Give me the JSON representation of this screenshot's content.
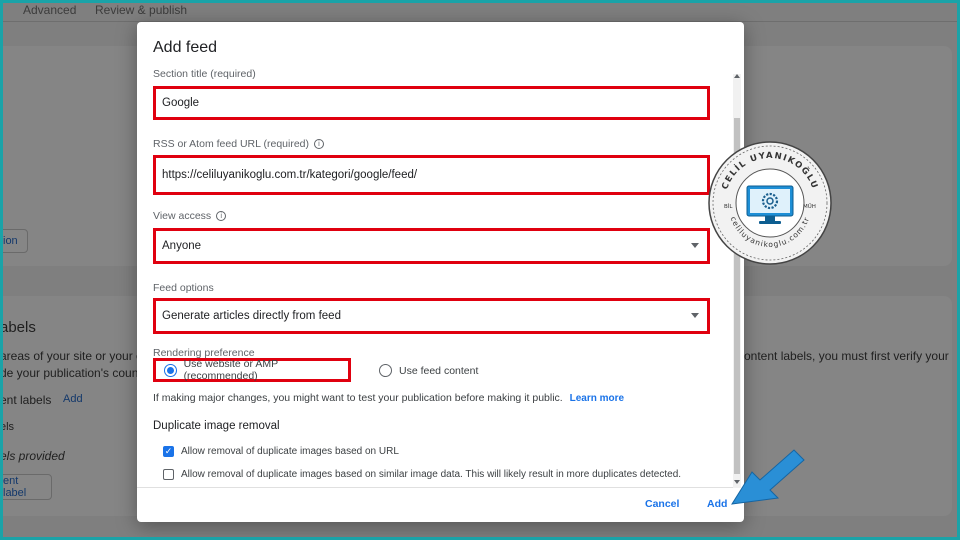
{
  "background": {
    "tabs": [
      "Advanced",
      "Review & publish"
    ],
    "partial_button_1": "ion",
    "labels_heading": "abels",
    "desc_line_1": "areas of your site or your ent",
    "desc_line_2": "de your publication's country",
    "right_text_1": "content labels, you must first verify your",
    "right_text_2": "r",
    "content_labels": "ent labels",
    "add_link": "Add",
    "labels_item": "els",
    "labels_provided": "els provided",
    "content_label_button": "ent label"
  },
  "dialog": {
    "title": "Add feed",
    "section_title": {
      "label": "Section title (required)",
      "value": "Google"
    },
    "feed_url": {
      "label": "RSS or Atom feed URL (required)",
      "value": "https://celiluyanikoglu.com.tr/kategori/google/feed/",
      "info_icon": "info-icon"
    },
    "view_access": {
      "label": "View access",
      "value": "Anyone",
      "info_icon": "info-icon"
    },
    "feed_options": {
      "label": "Feed options",
      "value": "Generate articles directly from feed"
    },
    "rendering": {
      "label": "Rendering preference",
      "option_amp": "Use website or AMP (recommended)",
      "option_feed": "Use feed content",
      "selected": "option_amp"
    },
    "hint": "If making major changes, you might want to test your publication before making it public.",
    "learn_more": "Learn more",
    "duplicate": {
      "heading": "Duplicate image removal",
      "url_option": "Allow removal of duplicate images based on URL",
      "url_checked": true,
      "similar_option": "Allow removal of duplicate images based on similar image data. This will likely result in more duplicates detected.",
      "similar_checked": false
    },
    "cancel": "Cancel",
    "add": "Add"
  },
  "stamp": {
    "name": "CELİL UYANIKOĞLU",
    "left": "BİL",
    "right": "MÜH",
    "site": "celiluyanikoglu.com.tr"
  },
  "colors": {
    "accent": "#1a73e8",
    "highlight": "#e0000f",
    "frame": "#1aa3a8",
    "arrow": "#2a8fd6"
  }
}
